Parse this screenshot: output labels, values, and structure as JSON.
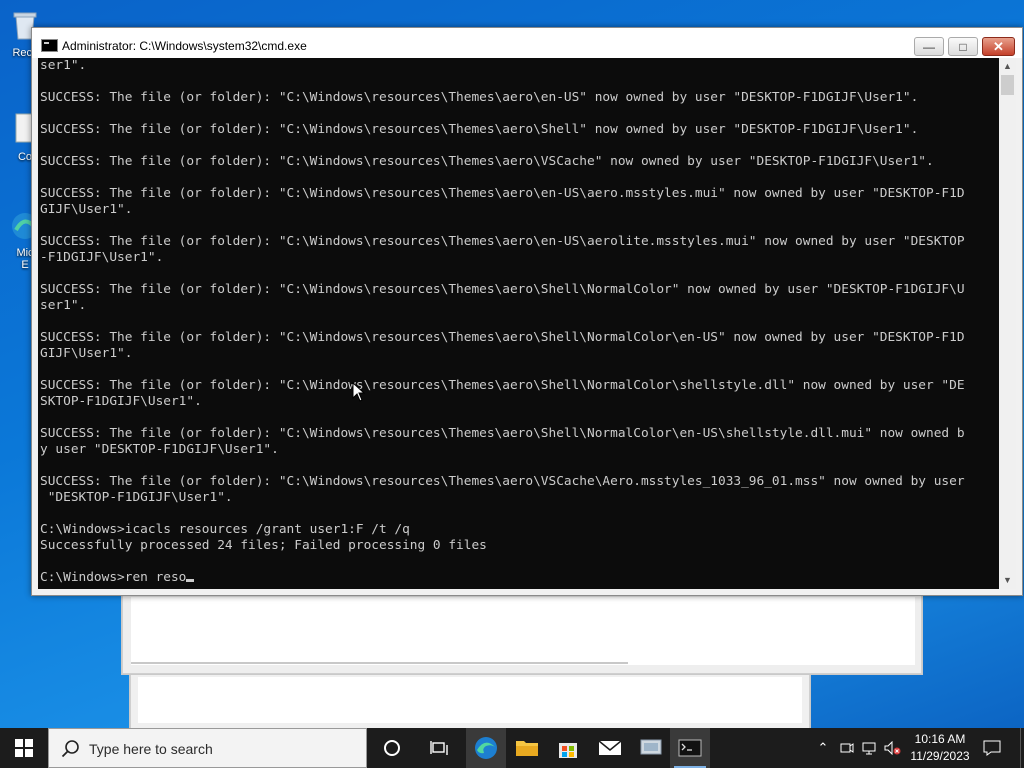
{
  "desktop": {
    "icons": [
      {
        "label": "Recy"
      },
      {
        "label": "Co"
      },
      {
        "label": "Mic\nE"
      }
    ]
  },
  "window": {
    "title": "Administrator: C:\\Windows\\system32\\cmd.exe",
    "minimize_label": "—",
    "maximize_label": "□",
    "close_label": "✕"
  },
  "console": {
    "lines": [
      "ser1\".",
      "",
      "SUCCESS: The file (or folder): \"C:\\Windows\\resources\\Themes\\aero\\en-US\" now owned by user \"DESKTOP-F1DGIJF\\User1\".",
      "",
      "SUCCESS: The file (or folder): \"C:\\Windows\\resources\\Themes\\aero\\Shell\" now owned by user \"DESKTOP-F1DGIJF\\User1\".",
      "",
      "SUCCESS: The file (or folder): \"C:\\Windows\\resources\\Themes\\aero\\VSCache\" now owned by user \"DESKTOP-F1DGIJF\\User1\".",
      "",
      "SUCCESS: The file (or folder): \"C:\\Windows\\resources\\Themes\\aero\\en-US\\aero.msstyles.mui\" now owned by user \"DESKTOP-F1D",
      "GIJF\\User1\".",
      "",
      "SUCCESS: The file (or folder): \"C:\\Windows\\resources\\Themes\\aero\\en-US\\aerolite.msstyles.mui\" now owned by user \"DESKTOP",
      "-F1DGIJF\\User1\".",
      "",
      "SUCCESS: The file (or folder): \"C:\\Windows\\resources\\Themes\\aero\\Shell\\NormalColor\" now owned by user \"DESKTOP-F1DGIJF\\U",
      "ser1\".",
      "",
      "SUCCESS: The file (or folder): \"C:\\Windows\\resources\\Themes\\aero\\Shell\\NormalColor\\en-US\" now owned by user \"DESKTOP-F1D",
      "GIJF\\User1\".",
      "",
      "SUCCESS: The file (or folder): \"C:\\Windows\\resources\\Themes\\aero\\Shell\\NormalColor\\shellstyle.dll\" now owned by user \"DE",
      "SKTOP-F1DGIJF\\User1\".",
      "",
      "SUCCESS: The file (or folder): \"C:\\Windows\\resources\\Themes\\aero\\Shell\\NormalColor\\en-US\\shellstyle.dll.mui\" now owned b",
      "y user \"DESKTOP-F1DGIJF\\User1\".",
      "",
      "SUCCESS: The file (or folder): \"C:\\Windows\\resources\\Themes\\aero\\VSCache\\Aero.msstyles_1033_96_01.mss\" now owned by user",
      " \"DESKTOP-F1DGIJF\\User1\".",
      "",
      "C:\\Windows>icacls resources /grant user1:F /t /q",
      "Successfully processed 24 files; Failed processing 0 files",
      ""
    ],
    "prompt_line": "C:\\Windows>ren reso"
  },
  "taskbar": {
    "search_placeholder": "Type here to search",
    "pinned": [
      "task-view",
      "edge",
      "file-explorer",
      "store",
      "mail",
      "control-panel",
      "cmd"
    ],
    "clock_time": "10:16 AM",
    "clock_date": "11/29/2023"
  },
  "colors": {
    "console_bg": "#0c0c0c",
    "console_fg": "#cccccc",
    "taskbar_bg": "#1c1c1c",
    "close_button": "#c4402a",
    "desktop_blue": "#0b78d8"
  }
}
